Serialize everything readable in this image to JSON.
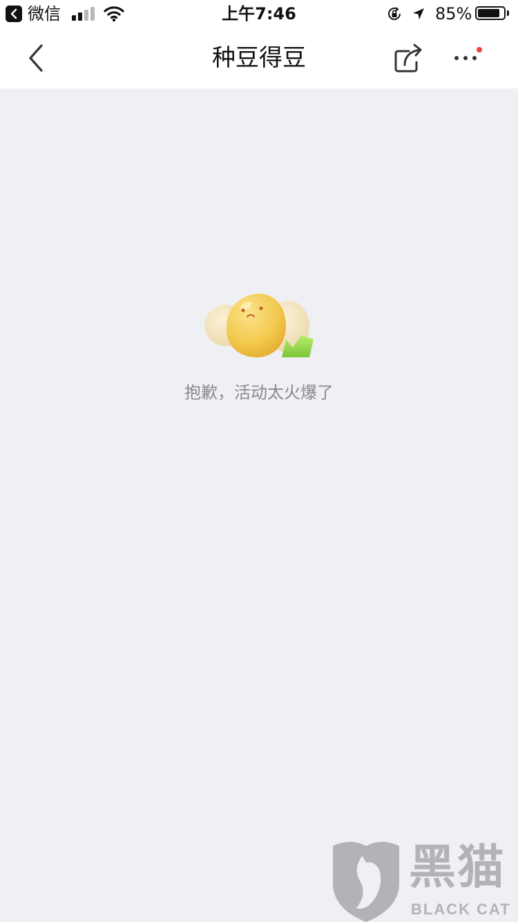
{
  "status_bar": {
    "app_label": "微信",
    "time": "上午7:46",
    "battery_percent": "85%",
    "battery_level": 0.85,
    "signal_bars_active": 2,
    "signal_bars_total": 4,
    "icons": [
      "back-to-app-icon",
      "signal-icon",
      "wifi-icon",
      "orientation-lock-icon",
      "location-arrow-icon",
      "battery-icon"
    ]
  },
  "nav": {
    "title": "种豆得豆",
    "icons": [
      "back-chevron-icon",
      "share-icon",
      "more-icon"
    ],
    "notification_dot_color": "#e9443a"
  },
  "main": {
    "empty_message": "抱歉，活动太火爆了",
    "illustration": "sad-bean-illustration"
  },
  "watermark": {
    "text_cn": "黑猫",
    "text_en": "BLACK CAT"
  },
  "colors": {
    "background": "#eff0f4",
    "bar_background": "#ffffff",
    "message_text": "#888a8f",
    "bean_yellow": "#f2c64c",
    "leaf_green": "#8fd34a"
  }
}
